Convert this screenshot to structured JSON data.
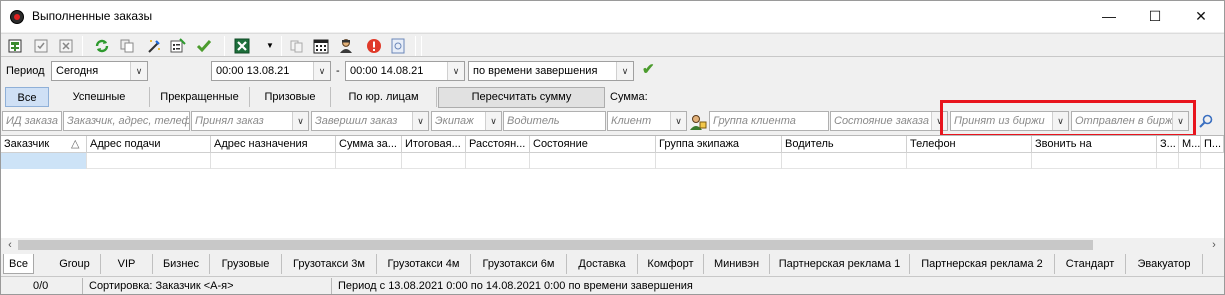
{
  "window": {
    "title": "Выполненные заказы",
    "minimize": "—",
    "maximize": "☐",
    "close": "✕"
  },
  "toolbar": {
    "icons": [
      "add-order-icon",
      "edit-order-icon",
      "delete-order-icon",
      "refresh-icon",
      "copy-icon",
      "magic-wand-icon",
      "properties-icon",
      "confirm-check-icon",
      "excel-export-icon",
      "dropdown-arrow-icon",
      "duplicate-icon",
      "calendar-icon",
      "driver-icon",
      "alert-icon",
      "document-icon"
    ]
  },
  "period": {
    "label": "Период",
    "preset": "Сегодня",
    "from": "00:00 13.08.21",
    "dash": "-",
    "to": "00:00 14.08.21",
    "mode": "по времени завершения"
  },
  "filter_tabs": {
    "items": [
      "Все",
      "Успешные",
      "Прекращенные",
      "Призовые",
      "По юр. лицам"
    ],
    "active": "Все",
    "recalc_button": "Пересчитать сумму",
    "sum_label": "Сумма:"
  },
  "filters": {
    "order_id": "ИД заказа",
    "customer": "Заказчик, адрес, телеф",
    "accepted": "Принял заказ",
    "completed": "Завершил заказ",
    "crew": "Экипаж",
    "driver": "Водитель",
    "client": "Клиент",
    "client_group": "Группа клиента",
    "order_state": "Состояние заказа",
    "from_exchange": "Принят из биржи",
    "to_exchange": "Отправлен в биржу"
  },
  "grid": {
    "columns": [
      "Заказчик",
      "Адрес подачи",
      "Адрес назначения",
      "Сумма за...",
      "Итоговая...",
      "Расстоян...",
      "Состояние",
      "Группа экипажа",
      "Водитель",
      "Телефон",
      "Звонить на",
      "З...",
      "М...",
      "П..."
    ],
    "sort_indicator": "△"
  },
  "scrollbar": {
    "left": "‹",
    "right": "›"
  },
  "bottom_tabs": {
    "items": [
      "Все",
      "Group",
      "VIP",
      "Бизнес",
      "Грузовые",
      "Грузотакси 3м",
      "Грузотакси 4м",
      "Грузотакси 6м",
      "Доставка",
      "Комфорт",
      "Минивэн",
      "Партнерская реклама 1",
      "Партнерская реклама 2",
      "Стандарт",
      "Эвакуатор"
    ],
    "active": "Все"
  },
  "status": {
    "count": "0/0",
    "sort": "Сортировка: Заказчик <А-я>",
    "period": "Период с 13.08.2021 0:00 по 14.08.2021 0:00 по времени завершения"
  },
  "colors": {
    "highlight_box": "#e8141d",
    "selection": "#cde3f7",
    "check_green": "#4c9c2e"
  }
}
